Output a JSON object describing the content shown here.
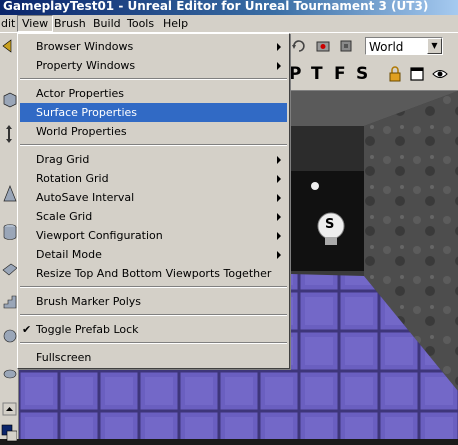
{
  "window": {
    "title": "GameplayTest01 - Unreal Editor for Unreal Tournament 3 (UT3)"
  },
  "menubar": [
    {
      "label": "dit"
    },
    {
      "label": "View"
    },
    {
      "label": "Brush"
    },
    {
      "label": "Build"
    },
    {
      "label": "Tools"
    },
    {
      "label": "Help"
    }
  ],
  "view_menu": {
    "items": [
      {
        "label": "Browser Windows",
        "submenu": true
      },
      {
        "label": "Property Windows",
        "submenu": true
      },
      {
        "label": "Actor Properties"
      },
      {
        "label": "Surface Properties",
        "highlighted": true
      },
      {
        "label": "World Properties"
      },
      {
        "label": "Drag Grid",
        "submenu": true
      },
      {
        "label": "Rotation Grid",
        "submenu": true
      },
      {
        "label": "AutoSave Interval",
        "submenu": true
      },
      {
        "label": "Scale Grid",
        "submenu": true
      },
      {
        "label": "Viewport Configuration",
        "submenu": true
      },
      {
        "label": "Detail Mode",
        "submenu": true
      },
      {
        "label": "Resize Top And Bottom Viewports Together"
      },
      {
        "label": "Brush Marker Polys"
      },
      {
        "label": "Toggle Prefab Lock",
        "checked": true
      },
      {
        "label": "Fullscreen"
      }
    ]
  },
  "toolbar": {
    "coordinate_system": "World",
    "view_letters": [
      "P",
      "T",
      "F",
      "S"
    ]
  },
  "viewport": {
    "actor_label": "S"
  },
  "colors": {
    "highlight": "#316ac5",
    "menu_bg": "#d4d0c8",
    "floor": "#6a5fc0"
  }
}
